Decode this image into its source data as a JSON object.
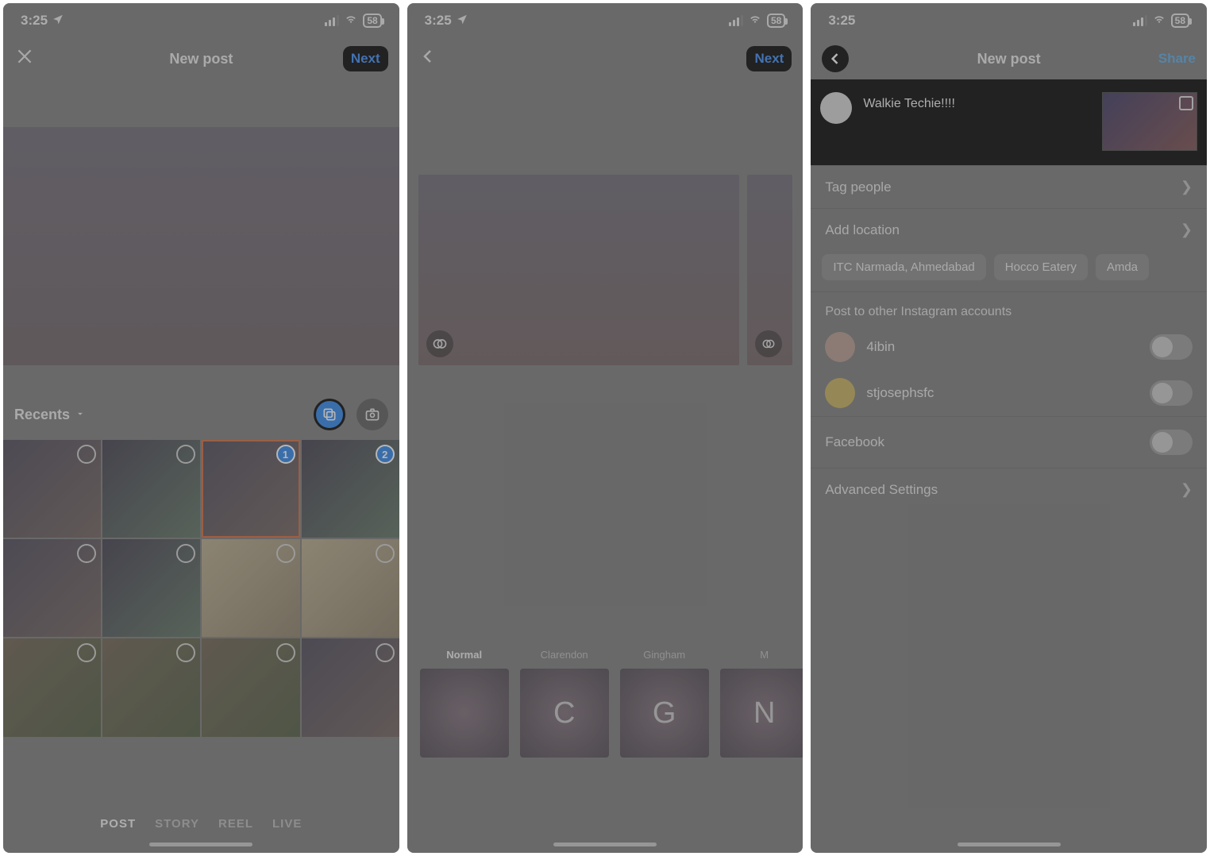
{
  "status": {
    "time": "3:25",
    "battery": "58"
  },
  "screen1": {
    "title": "New post",
    "next": "Next",
    "album": "Recents",
    "sel1": "1",
    "sel2": "2",
    "modes": {
      "post": "POST",
      "story": "STORY",
      "reel": "REEL",
      "live": "LIVE"
    }
  },
  "screen2": {
    "next": "Next",
    "filters": {
      "normal": "Normal",
      "clarendon": "Clarendon",
      "gingham": "Gingham",
      "moon": "M",
      "c_glyph": "C",
      "g_glyph": "G",
      "m_glyph": "N"
    }
  },
  "screen3": {
    "title": "New post",
    "share": "Share",
    "caption": "Walkie Techie!!!!",
    "rows": {
      "tag": "Tag people",
      "loc": "Add location",
      "crosspost": "Post to other Instagram accounts",
      "fb": "Facebook",
      "adv": "Advanced Settings"
    },
    "chips": {
      "c1": "ITC Narmada, Ahmedabad",
      "c2": "Hocco Eatery",
      "c3": "Amda"
    },
    "accounts": {
      "a1": "4ibin",
      "a2": "stjosephsfc"
    }
  }
}
